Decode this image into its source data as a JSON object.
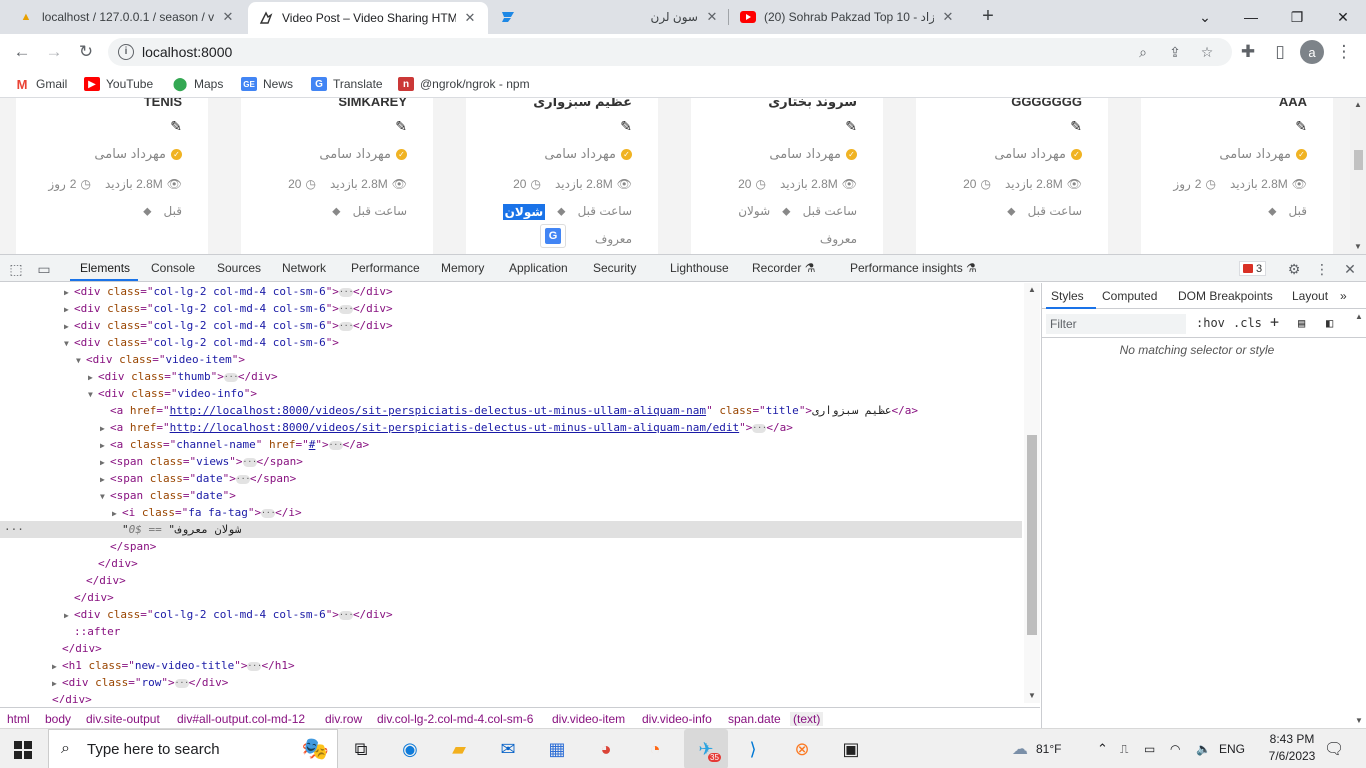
{
  "browser": {
    "tabs": [
      {
        "title": "localhost / 127.0.0.1 / season / v",
        "favicon": "phpmyadmin-icon"
      },
      {
        "title": "Video Post – Video Sharing HTM",
        "favicon": "video-icon"
      },
      {
        "title": "",
        "favicon": "stream-icon"
      },
      {
        "title": "سون لرن",
        "favicon": "page-icon"
      },
      {
        "title": "(20) Sohrab Pakzad Top 10 - کزاد",
        "favicon": "youtube-icon"
      }
    ],
    "url": "localhost:8000",
    "avatar_letter": "a"
  },
  "bookmarks": [
    {
      "label": "Gmail",
      "icon": "gmail-icon"
    },
    {
      "label": "YouTube",
      "icon": "youtube-icon"
    },
    {
      "label": "Maps",
      "icon": "maps-icon"
    },
    {
      "label": "News",
      "icon": "news-icon"
    },
    {
      "label": "Translate",
      "icon": "translate-icon"
    },
    {
      "label": "@ngrok/ngrok - npm",
      "icon": "npm-icon"
    }
  ],
  "page": {
    "cards": [
      {
        "title": "AAA",
        "channel": "مهرداد سامی",
        "views": "2.8M بازدید",
        "age_num": "2",
        "age_unit": "روز",
        "date": "قبل",
        "tag": "",
        "tag2": ""
      },
      {
        "title": "GGGGGGG",
        "channel": "مهرداد سامی",
        "views": "2.8M بازدید",
        "age_num": "20",
        "age_unit": "",
        "date": "ساعت قبل",
        "tag": "",
        "tag2": ""
      },
      {
        "title": "سروند بختاری",
        "channel": "مهرداد سامی",
        "views": "2.8M بازدید",
        "age_num": "20",
        "age_unit": "",
        "date": "ساعت قبل",
        "tag": "شولان",
        "tag2": "معروف"
      },
      {
        "title": "عظیم سبزواری",
        "channel": "مهرداد سامی",
        "views": "2.8M بازدید",
        "age_num": "20",
        "age_unit": "",
        "date": "ساعت قبل",
        "tag": "شولان",
        "tag2": "معروف"
      },
      {
        "title": "SIMKAREY",
        "channel": "مهرداد سامی",
        "views": "2.8M بازدید",
        "age_num": "20",
        "age_unit": "",
        "date": "ساعت قبل",
        "tag": "",
        "tag2": ""
      },
      {
        "title": "TENIS",
        "channel": "مهرداد سامی",
        "views": "2.8M بازدید",
        "age_num": "2",
        "age_unit": "روز",
        "date": "قبل",
        "tag": "",
        "tag2": ""
      }
    ]
  },
  "devtools": {
    "tabs": [
      "Elements",
      "Console",
      "Sources",
      "Network",
      "Performance",
      "Memory",
      "Application",
      "Security",
      "Lighthouse",
      "Recorder",
      "Performance insights"
    ],
    "error_count": "3",
    "dom": {
      "col_class": "col-lg-2 col-md-4 col-sm-6",
      "video_item": "video-item",
      "thumb": "thumb",
      "video_info": "video-info",
      "title_href": "http://localhost:8000/videos/sit-perspiciatis-delectus-ut-minus-ullam-aliquam-nam",
      "title_text": "عظیم سبزواری",
      "title_class": "title",
      "edit_href": "http://localhost:8000/videos/sit-perspiciatis-delectus-ut-minus-ullam-aliquam-nam/edit",
      "channel_class": "channel-name",
      "channel_href": "#",
      "views_class": "views",
      "date_class": "date",
      "icon_class": "fa fa-tag",
      "selected_text": "\"شولان معروف\"",
      "selected_marker": "== $0",
      "after": "::after",
      "h1_class": "new-video-title",
      "row_class": "row"
    },
    "breadcrumbs": [
      "html",
      "body",
      "div.site-output",
      "div#all-output.col-md-12",
      "div.row",
      "div.col-lg-2.col-md-4.col-sm-6",
      "div.video-item",
      "div.video-info",
      "span.date",
      "(text)"
    ],
    "styles_tabs": [
      "Styles",
      "Computed",
      "DOM Breakpoints",
      "Layout"
    ],
    "filter_placeholder": "Filter",
    "hov": ":hov",
    "cls": ".cls",
    "no_match": "No matching selector or style"
  },
  "taskbar": {
    "search_placeholder": "Type here to search",
    "weather": "81°F",
    "lang": "ENG",
    "time": "8:43 PM",
    "date": "7/6/2023",
    "telegram_badge": "35"
  },
  "colors": {
    "accent": "#1a73e8",
    "devtools_tag": "#881280",
    "attr_name": "#994500",
    "attr_value": "#1a1aa6"
  }
}
